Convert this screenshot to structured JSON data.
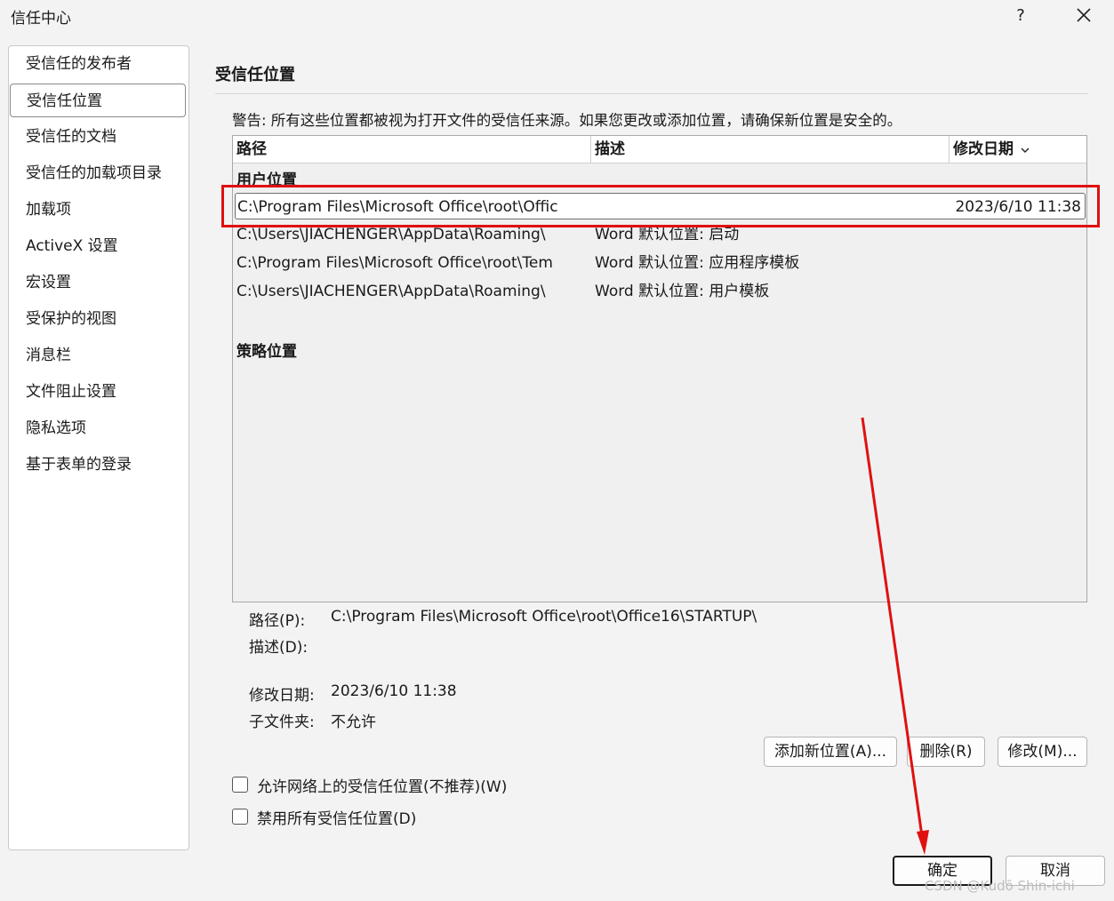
{
  "window": {
    "title": "信任中心",
    "help_label": "?"
  },
  "sidebar": {
    "items": [
      {
        "label": "受信任的发布者"
      },
      {
        "label": "受信任位置"
      },
      {
        "label": "受信任的文档"
      },
      {
        "label": "受信任的加载项目录"
      },
      {
        "label": "加载项"
      },
      {
        "label": "ActiveX 设置"
      },
      {
        "label": "宏设置"
      },
      {
        "label": "受保护的视图"
      },
      {
        "label": "消息栏"
      },
      {
        "label": "文件阻止设置"
      },
      {
        "label": "隐私选项"
      },
      {
        "label": "基于表单的登录"
      }
    ],
    "active_index": 1
  },
  "main": {
    "title": "受信任位置",
    "warning": "警告: 所有这些位置都被视为打开文件的受信任来源。如果您更改或添加位置，请确保新位置是安全的。",
    "columns": {
      "path": "路径",
      "desc": "描述",
      "date": "修改日期"
    },
    "groups": {
      "user": "用户位置",
      "policy": "策略位置"
    },
    "rows": [
      {
        "path": "C:\\Program Files\\Microsoft Office\\root\\Offic",
        "desc": "",
        "date": "2023/6/10 11:38"
      },
      {
        "path": "C:\\Users\\JIACHENGER\\AppData\\Roaming\\",
        "desc": "Word 默认位置: 启动",
        "date": ""
      },
      {
        "path": "C:\\Program Files\\Microsoft Office\\root\\Tem",
        "desc": "Word 默认位置: 应用程序模板",
        "date": ""
      },
      {
        "path": "C:\\Users\\JIACHENGER\\AppData\\Roaming\\",
        "desc": "Word 默认位置: 用户模板",
        "date": ""
      }
    ],
    "details": {
      "path_label": "路径(P):",
      "path_value": "C:\\Program Files\\Microsoft Office\\root\\Office16\\STARTUP\\",
      "desc_label": "描述(D):",
      "date_label": "修改日期:",
      "date_value": "2023/6/10 11:38",
      "subfolder_label": "子文件夹:",
      "subfolder_value": "不允许"
    },
    "buttons": {
      "add": "添加新位置(A)...",
      "remove": "删除(R)",
      "modify": "修改(M)..."
    },
    "checkboxes": {
      "allow_network": "允许网络上的受信任位置(不推荐)(W)",
      "disable_all": "禁用所有受信任位置(D)"
    }
  },
  "footer": {
    "ok": "确定",
    "cancel": "取消"
  },
  "watermark": "CSDN @Kudō Shin-ichi",
  "colors": {
    "annotation": "#e01010",
    "background": "#f3f3f3"
  }
}
